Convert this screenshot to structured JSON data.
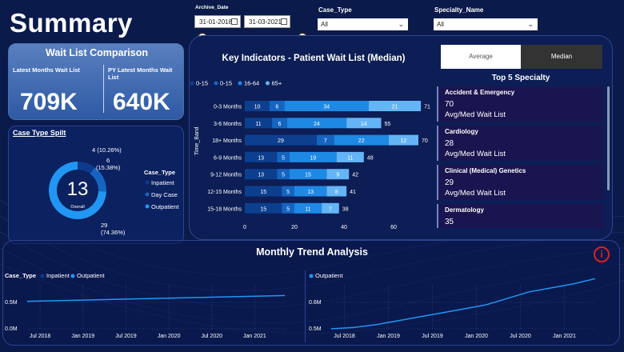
{
  "title": "Summary",
  "filters": {
    "archive_label": "Archive_Date",
    "date_from": "31-01-2018",
    "date_to": "31-03-2021",
    "case_type_label": "Case_Type",
    "case_type_value": "All",
    "specialty_label": "Specialty_Name",
    "specialty_value": "All"
  },
  "wait_list": {
    "title": "Wait List Comparison",
    "latest_label": "Latest Months Wait List",
    "latest_value": "709K",
    "py_label": "PY Latest Months Wait List",
    "py_value": "640K"
  },
  "case_type_split": {
    "title": "Case Type Spilt",
    "center_value": "13",
    "center_label": "Overall",
    "legend_title": "Case_Type",
    "legend": [
      "Inpatient",
      "Day Case",
      "Outpatient"
    ],
    "colors": [
      "#0d3a8c",
      "#1565c0",
      "#2196f3"
    ],
    "labels": [
      {
        "count": "4",
        "pct": "(10.26%)"
      },
      {
        "count": "6",
        "pct": "(15.38%)"
      },
      {
        "count": "29",
        "pct": "(74.36%)"
      }
    ]
  },
  "key_indicators": {
    "title": "Key Indicators - Patient Wait List (Median)",
    "toggle_avg": "Average",
    "toggle_med": "Median",
    "axis_label": "Time_Band"
  },
  "chart_data": [
    {
      "type": "bar",
      "title": "Key Indicators - Patient Wait List (Median)",
      "ylabel": "Time_Band",
      "categories": [
        "0-3 Months",
        "3-6 Months",
        "18+ Months",
        "6-9 Months",
        "9-12 Months",
        "12-15 Months",
        "15-18 Months"
      ],
      "series": [
        {
          "name": "0-15",
          "color": "#0d3f8f",
          "values": [
            10,
            11,
            29,
            13,
            13,
            15,
            15
          ]
        },
        {
          "name": "0-15",
          "color": "#1565c0",
          "values": [
            6,
            6,
            7,
            5,
            5,
            5,
            5
          ]
        },
        {
          "name": "16-64",
          "color": "#1e88e5",
          "values": [
            34,
            24,
            22,
            19,
            15,
            13,
            11
          ]
        },
        {
          "name": "65+",
          "color": "#64b5f6",
          "values": [
            21,
            14,
            12,
            11,
            9,
            8,
            7
          ]
        }
      ],
      "totals": [
        71,
        55,
        70,
        48,
        42,
        41,
        38
      ],
      "xlim": [
        0,
        70
      ],
      "xticks": [
        0,
        20,
        40,
        60
      ]
    },
    {
      "type": "line",
      "title": "Monthly Trend Analysis",
      "legend_title": "Case_Type",
      "series_names": [
        "Inpatient",
        "Outpatient"
      ],
      "x": [
        "Jul 2018",
        "Jan 2019",
        "Jul 2019",
        "Jan 2020",
        "Jul 2020",
        "Jan 2021"
      ],
      "yticks": [
        "0.5M",
        "0.0M"
      ],
      "series": [
        {
          "name": "Outpatient",
          "values": [
            0.52,
            0.53,
            0.54,
            0.55,
            0.56,
            0.57,
            0.58,
            0.59,
            0.6,
            0.61,
            0.62,
            0.63
          ]
        }
      ]
    },
    {
      "type": "line",
      "legend": [
        "Outpatient"
      ],
      "x": [
        "Jul 2018",
        "Jan 2019",
        "Jul 2019",
        "Jan 2020",
        "Jul 2020",
        "Jan 2021"
      ],
      "yticks": [
        "0.6M",
        "0.5M"
      ],
      "series": [
        {
          "name": "Outpatient",
          "values": [
            0.5,
            0.505,
            0.515,
            0.53,
            0.545,
            0.56,
            0.575,
            0.59,
            0.615,
            0.64,
            0.655,
            0.67,
            0.69
          ]
        }
      ]
    }
  ],
  "top5": {
    "title": "Top 5 Specialty",
    "items": [
      {
        "name": "Accident & Emergency",
        "value": "70",
        "label": "Avg/Med Wait List"
      },
      {
        "name": "Cardiology",
        "value": "28",
        "label": "Avg/Med Wait List"
      },
      {
        "name": "Clinical (Medical) Genetics",
        "value": "29",
        "label": "Avg/Med Wait List"
      },
      {
        "name": "Dermatology",
        "value": "35",
        "label": "Avg/Med Wait List"
      }
    ]
  },
  "monthly_trend": {
    "title": "Monthly Trend Analysis",
    "left_legend_title": "Case_Type",
    "left_legend": [
      "Inpatient",
      "Outpatient"
    ],
    "right_legend": [
      "Outpatient"
    ]
  }
}
